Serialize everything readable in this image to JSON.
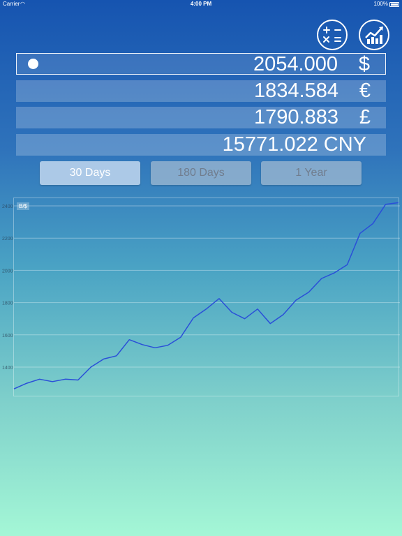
{
  "status_bar": {
    "carrier": "Carrier",
    "time": "4:00 PM",
    "battery": "100%"
  },
  "toolbar": {
    "calculator_icon": "calculator-icon",
    "chart_icon": "trend-chart-icon"
  },
  "rates": [
    {
      "value": "2054.000",
      "unit": "$",
      "selected": true
    },
    {
      "value": "1834.584",
      "unit": "€",
      "selected": false
    },
    {
      "value": "1790.883",
      "unit": "£",
      "selected": false
    },
    {
      "value": "15771.022 CNY",
      "unit": "",
      "selected": false
    }
  ],
  "periods": [
    {
      "label": "30 Days",
      "active": true
    },
    {
      "label": "180 Days",
      "active": false
    },
    {
      "label": "1 Year",
      "active": false
    }
  ],
  "colors": {
    "line": "#2a4fd8",
    "grid": "rgba(255,255,255,0.35)"
  },
  "chart_data": {
    "type": "line",
    "series_label": "B/$",
    "y_ticks": [
      "2400",
      "2200",
      "2000",
      "1800",
      "1600",
      "1400"
    ],
    "y_tick_values": [
      2400,
      2200,
      2000,
      1800,
      1600,
      1400
    ],
    "ylim": [
      1300,
      2430
    ],
    "grid": true,
    "x": [
      0,
      1,
      2,
      3,
      4,
      5,
      6,
      7,
      8,
      9,
      10,
      11,
      12,
      13,
      14,
      15,
      16,
      17,
      18,
      19,
      20,
      21,
      22,
      23,
      24,
      25,
      26,
      27,
      28,
      29,
      30
    ],
    "values": [
      1265,
      1300,
      1325,
      1310,
      1325,
      1320,
      1400,
      1450,
      1470,
      1570,
      1540,
      1520,
      1535,
      1585,
      1705,
      1760,
      1825,
      1740,
      1700,
      1760,
      1670,
      1725,
      1815,
      1865,
      1950,
      1985,
      2035,
      2230,
      2290,
      2410,
      2420
    ]
  }
}
